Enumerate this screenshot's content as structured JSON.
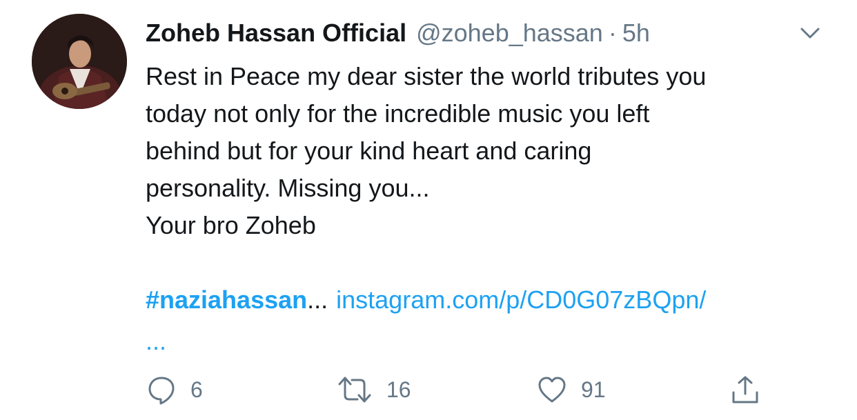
{
  "tweet": {
    "display_name": "Zoheb Hassan Official",
    "handle": "@zoheb_hassan",
    "separator": "·",
    "time": "5h",
    "text_lines": [
      "Rest in Peace my dear sister the world tributes you",
      "today not only for the incredible music you left",
      "behind but for your kind heart and caring",
      "personality. Missing you...",
      "Your bro Zoheb"
    ],
    "hashtag": "#naziahassan",
    "hashtag_ellipsis": "...",
    "link": "instagram.com/p/CD0G07zBQpn/",
    "link_ellipsis": "..."
  },
  "actions": {
    "reply_count": "6",
    "retweet_count": "16",
    "like_count": "91"
  },
  "icons": {
    "menu": "chevron-down-icon",
    "reply": "reply-icon",
    "retweet": "retweet-icon",
    "like": "heart-icon",
    "share": "share-icon"
  },
  "colors": {
    "text": "#14171a",
    "secondary": "#657786",
    "link": "#1da1f2"
  }
}
